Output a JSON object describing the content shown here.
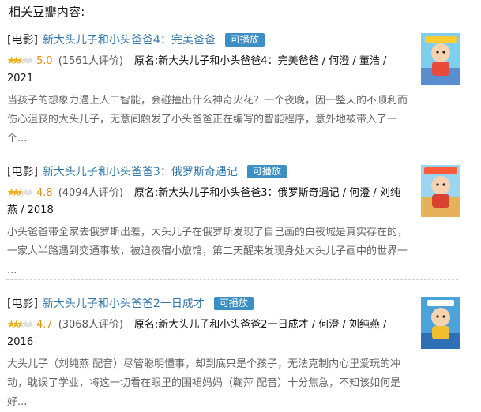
{
  "heading": "相关豆瓣内容:",
  "items": [
    {
      "category": "[电影]",
      "title": "新大头儿子和小头爸爸4：完美爸爸",
      "tag": "可播放",
      "rating": "5.0",
      "votes": "(1561人评价)",
      "meta_line1": "原名:新大头儿子和小头爸爸4：完美爸爸 / 何澄 / 董浩 /",
      "meta_line2": "2021",
      "desc_line1": "当孩子的想象力遇上人工智能，会碰撞出什么神奇火花？一个夜晚，因一整天的不顺利而",
      "desc_line2": "伤心沮丧的大头儿子，无意间触发了小头爸爸正在编写的智能程序，意外地被带入了一",
      "desc_line3": "个...",
      "stars": 2.5,
      "poster_icon": "movie-poster-image"
    },
    {
      "category": "[电影]",
      "title": "新大头儿子和小头爸爸3：俄罗斯奇遇记",
      "tag": "可播放",
      "rating": "4.8",
      "votes": "(4094人评价)",
      "meta_line1": "原名:新大头儿子和小头爸爸3：俄罗斯奇遇记 / 何澄 / 刘纯",
      "meta_line2": "燕 / 2018",
      "desc_line1": "小头爸爸带全家去俄罗斯出差，大头儿子在俄罗斯发现了自己画的白夜城是真实存在的，",
      "desc_line2": "一家人半路遇到交通事故，被迫夜宿小旅馆，第二天醒来发现身处大头儿子画中的世界一",
      "desc_line3": "...",
      "stars": 2.5,
      "poster_icon": "movie-poster-image"
    },
    {
      "category": "[电影]",
      "title": "新大头儿子和小头爸爸2一日成才",
      "tag": "可播放",
      "rating": "4.7",
      "votes": "(3068人评价)",
      "meta_line1": "原名:新大头儿子和小头爸爸2一日成才 / 何澄 / 刘纯燕 /",
      "meta_line2": "2016",
      "desc_line1": "大头儿子（刘纯燕 配音）尽管聪明懂事，却到底只是个孩子，无法克制内心里爱玩的冲",
      "desc_line2": "动，耽误了学业，将这一切看在眼里的围裙妈妈（鞠萍 配音）十分焦急，不知该如何是",
      "desc_line3": "好...",
      "stars": 2.5,
      "poster_icon": "movie-poster-image"
    }
  ],
  "colors": {
    "link": "#3377aa",
    "tag_bg": "#3d8fc3",
    "rating": "#e09015",
    "star_on": "#f2b01e",
    "star_off": "#dddddd"
  }
}
